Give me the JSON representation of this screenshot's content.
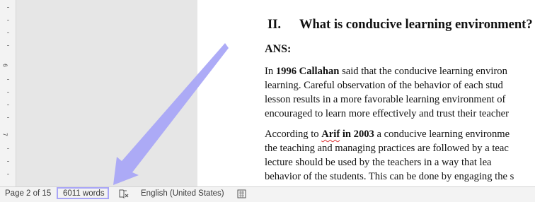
{
  "ruler": {
    "labels": [
      "6",
      "7"
    ]
  },
  "document": {
    "heading_number": "II.",
    "heading_text": "What is conducive learning environment?",
    "ans_label": "ANS:",
    "p1": {
      "l1_pre": "In ",
      "l1_bold": "1996 Callahan",
      "l1_post": " said that the conducive learning environ",
      "l2": "learning. Careful observation of the behavior of each stud",
      "l3": "lesson results in a more favorable learning environment of",
      "l4": "encouraged to learn more effectively and trust their teacher"
    },
    "p2": {
      "l1_pre": "According to ",
      "l1_bold_squiggle": "Arif",
      "l1_bold_rest": " in 2003",
      "l1_post": " a conducive learning environme",
      "l2": "the teaching and managing practices are followed by a teac",
      "l3": "lecture should be used by the teachers in a way that lea",
      "l4": "behavior of the students. This can be done by engaging the s"
    }
  },
  "statusbar": {
    "page": "Page 2 of 15",
    "words": "6011 words",
    "proofing_icon": "proofing-book-icon",
    "language": "English (United States)",
    "macro_icon": "macro-record-icon"
  },
  "annotation": {
    "arrow_color": "#a9a6f7",
    "highlight_color": "#a9a6f7"
  }
}
